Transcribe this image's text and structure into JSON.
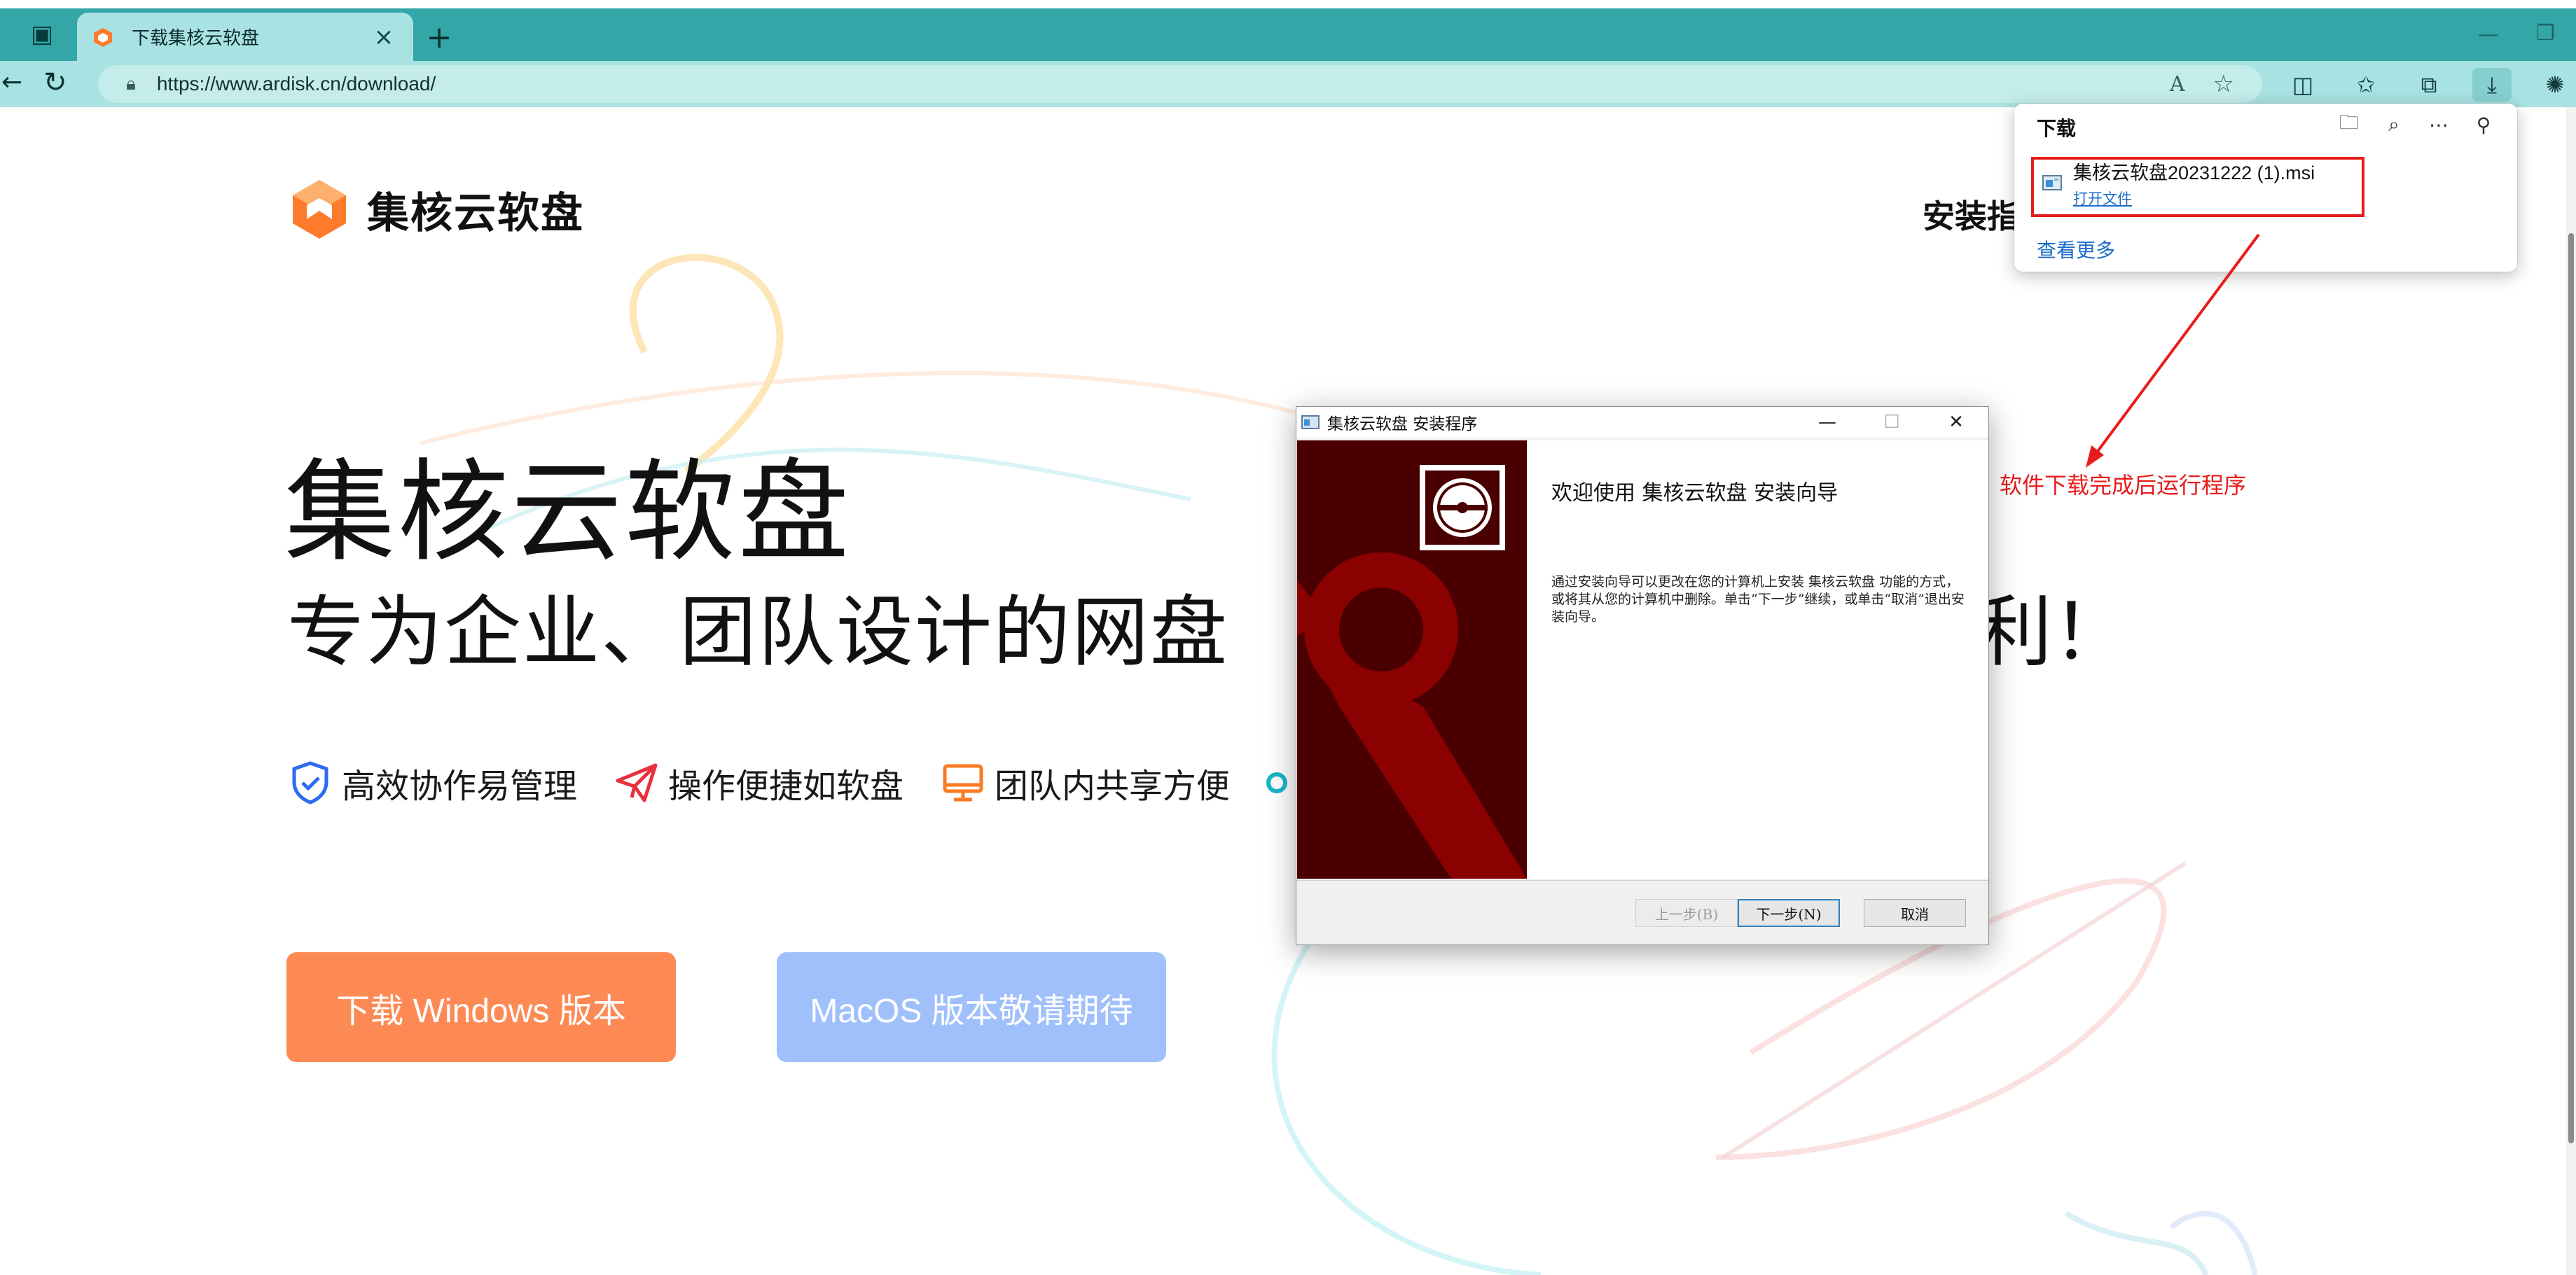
{
  "browser": {
    "tab_title": "下载集核云软盘",
    "url": "https://www.ardisk.cn/download/",
    "read_aloud_label": "A",
    "icons": [
      "sidebar-icon",
      "favorites-star-icon",
      "split-screen-icon",
      "favorites-icon",
      "collections-icon",
      "downloads-icon",
      "copilot-icon"
    ]
  },
  "site": {
    "logo_text": "集核云软盘",
    "nav_guide": "安装指南",
    "hero_title": "集核云软盘",
    "hero_subtitle": "专为企业、团队设计的网盘",
    "hero_subtitle_end": "利！",
    "features": [
      {
        "label": "高效协作易管理",
        "icon": "shield-check-icon",
        "color": "#2d6bf0"
      },
      {
        "label": "操作便捷如软盘",
        "icon": "paper-plane-icon",
        "color": "#e8303a"
      },
      {
        "label": "团队内共享方便",
        "icon": "monitor-icon",
        "color": "#fa7a22"
      }
    ],
    "btn_windows": "下载 Windows 版本",
    "btn_mac": "MacOS 版本敬请期待"
  },
  "downloads": {
    "title": "下载",
    "file_name": "集核云软盘20231222 (1).msi",
    "open_file": "打开文件",
    "see_more": "查看更多"
  },
  "annotation": {
    "text": "软件下载完成后运行程序",
    "color": "#e81c1c"
  },
  "installer": {
    "title": "集核云软盘 安装程序",
    "welcome": "欢迎使用 集核云软盘 安装向导",
    "description": "通过安装向导可以更改在您的计算机上安装 集核云软盘 功能的方式，或将其从您的计算机中删除。单击“下一步”继续，或单击“取消”退出安装向导。",
    "btn_back": "上一步(B)",
    "btn_next": "下一步(N)",
    "btn_cancel": "取消"
  },
  "colors": {
    "tab_bar": "#34a6a7",
    "address_row": "#a8e2e2",
    "windows_button": "#fd8a55",
    "mac_button": "#9fc0fb",
    "installer_side": "#4a0000"
  }
}
